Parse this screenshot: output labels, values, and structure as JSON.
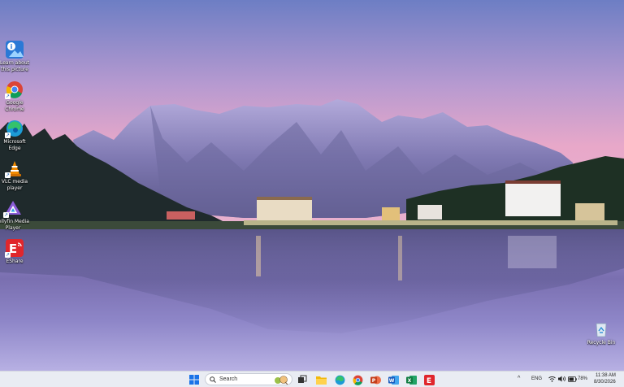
{
  "desktop": {
    "icons": [
      {
        "label": "Learn about this picture",
        "icon": "info-landscape-icon"
      },
      {
        "label": "Google Chrome",
        "icon": "chrome-icon"
      },
      {
        "label": "Microsoft Edge",
        "icon": "edge-icon"
      },
      {
        "label": "VLC media player",
        "icon": "vlc-cone-icon"
      },
      {
        "label": "Jellyfin Media Player",
        "icon": "jellyfin-icon"
      },
      {
        "label": "EShare",
        "icon": "eshare-icon"
      },
      {
        "label": "Recycle Bin",
        "icon": "recycle-bin-icon"
      }
    ]
  },
  "taskbar": {
    "search_placeholder": "Search",
    "apps": [
      "start-icon",
      "task-view-icon",
      "file-explorer-icon",
      "edge-icon",
      "chrome-icon",
      "powerpoint-icon",
      "word-icon",
      "excel-icon",
      "eshare-icon"
    ],
    "tray": {
      "chevron": "^",
      "language": "ENG",
      "battery": "78%",
      "time": "11:38 AM",
      "date": "8/30/2026"
    }
  },
  "colors": {
    "taskbar_bg": "#e9ecf3",
    "sky_top": "#6f7fc2",
    "sky_bottom": "#e7a9c9",
    "lake": "#8f86c8"
  }
}
